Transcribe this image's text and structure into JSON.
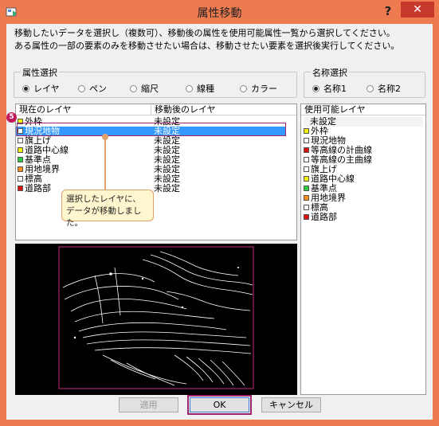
{
  "window": {
    "title": "属性移動",
    "help_label": "?",
    "close_label": "✕"
  },
  "description": {
    "line1": "移動したいデータを選択し（複数可）、移動後の属性を使用可能属性一覧から選択してください。",
    "line2": "ある属性の一部の要素のみを移動させたい場合は、移動させたい要素を選択後実行してください。"
  },
  "attribute_select": {
    "legend": "属性選択",
    "options": [
      "レイヤ",
      "ペン",
      "縮尺",
      "線種",
      "カラー"
    ],
    "selected": "レイヤ"
  },
  "name_select": {
    "legend": "名称選択",
    "options": [
      "名称1",
      "名称2"
    ],
    "selected": "名称1"
  },
  "layer_table": {
    "col_current": "現在のレイヤ",
    "col_target": "移動後のレイヤ",
    "rows": [
      {
        "name": "外枠",
        "target": "未設定",
        "color": "#f2f200"
      },
      {
        "name": "現況地物",
        "target": "未設定",
        "color": "#ffffff",
        "selected": true
      },
      {
        "name": "旗上げ",
        "target": "未設定",
        "color": "#ffffff"
      },
      {
        "name": "道路中心線",
        "target": "未設定",
        "color": "#f2f200"
      },
      {
        "name": "基準点",
        "target": "未設定",
        "color": "#2ecc40"
      },
      {
        "name": "用地境界",
        "target": "未設定",
        "color": "#ff8c1a"
      },
      {
        "name": "標高",
        "target": "未設定",
        "color": "#ffffff"
      },
      {
        "name": "道路部",
        "target": "未設定",
        "color": "#e01010"
      }
    ]
  },
  "usable_layers": {
    "header": "使用可能レイヤ",
    "items": [
      {
        "name": "未設定",
        "color": ""
      },
      {
        "name": "外枠",
        "color": "#f2f200"
      },
      {
        "name": "現況地物",
        "color": "#ffffff"
      },
      {
        "name": "等高線の計曲線",
        "color": "#e01010"
      },
      {
        "name": "等高線の主曲線",
        "color": "#ffffff"
      },
      {
        "name": "旗上げ",
        "color": "#ffffff"
      },
      {
        "name": "道路中心線",
        "color": "#f2f200"
      },
      {
        "name": "基準点",
        "color": "#2ecc40"
      },
      {
        "name": "用地境界",
        "color": "#ff8c1a"
      },
      {
        "name": "標高",
        "color": "#ffffff"
      },
      {
        "name": "道路部",
        "color": "#e01010"
      }
    ]
  },
  "callout": {
    "step": "5",
    "line1": "選択したレイヤに、",
    "line2": "データが移動しました。"
  },
  "buttons": {
    "apply": "適用",
    "ok": "OK",
    "cancel": "キャンセル"
  },
  "colors": {
    "title_bar": "#ee7b4f",
    "close": "#c7392c",
    "selection": "#3399ff",
    "highlight_frame": "#a0246b",
    "callout_border": "#e1a16a"
  }
}
